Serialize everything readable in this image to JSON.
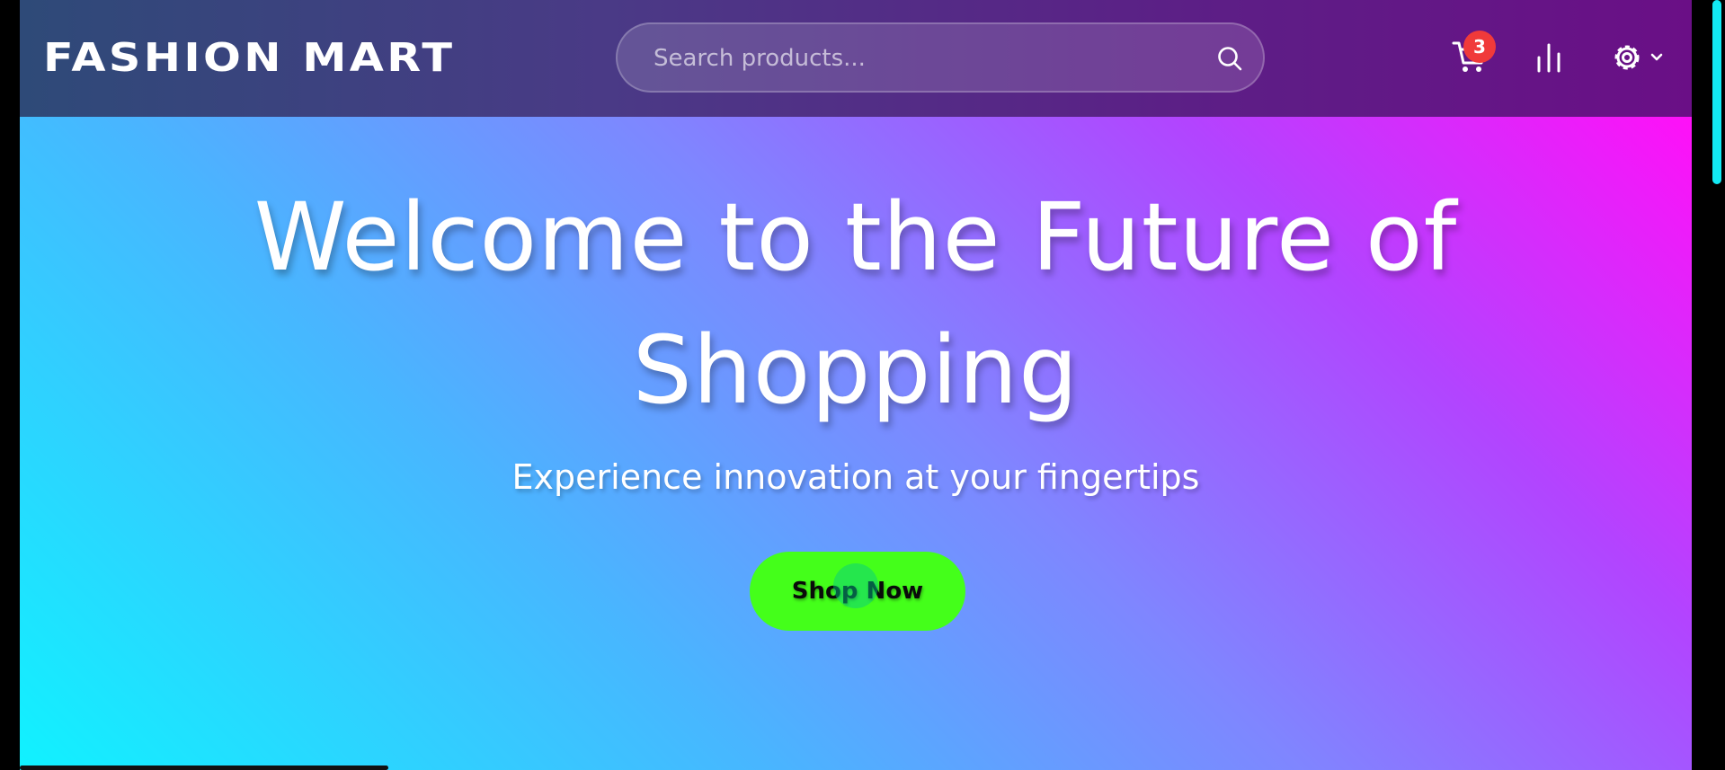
{
  "brand": {
    "name": "FASHION MART"
  },
  "search": {
    "placeholder": "Search products...",
    "icon": "search-icon"
  },
  "nav": {
    "cart_icon": "shopping-cart-icon",
    "cart_badge": "3",
    "stats_icon": "bar-chart-icon",
    "settings_icon": "gear-icon",
    "settings_dropdown_icon": "chevron-down-icon"
  },
  "hero": {
    "title": "Welcome to the Future of Shopping",
    "subtitle": "Experience innovation at your fingertips",
    "cta_label": "Shop Now"
  },
  "colors": {
    "cta_background": "#44ff1a",
    "badge": "#f03a3a",
    "hero_gradient_start": "#10f2ff",
    "hero_gradient_end": "#ff10f8",
    "scrollbar_thumb": "#12e9f4"
  }
}
